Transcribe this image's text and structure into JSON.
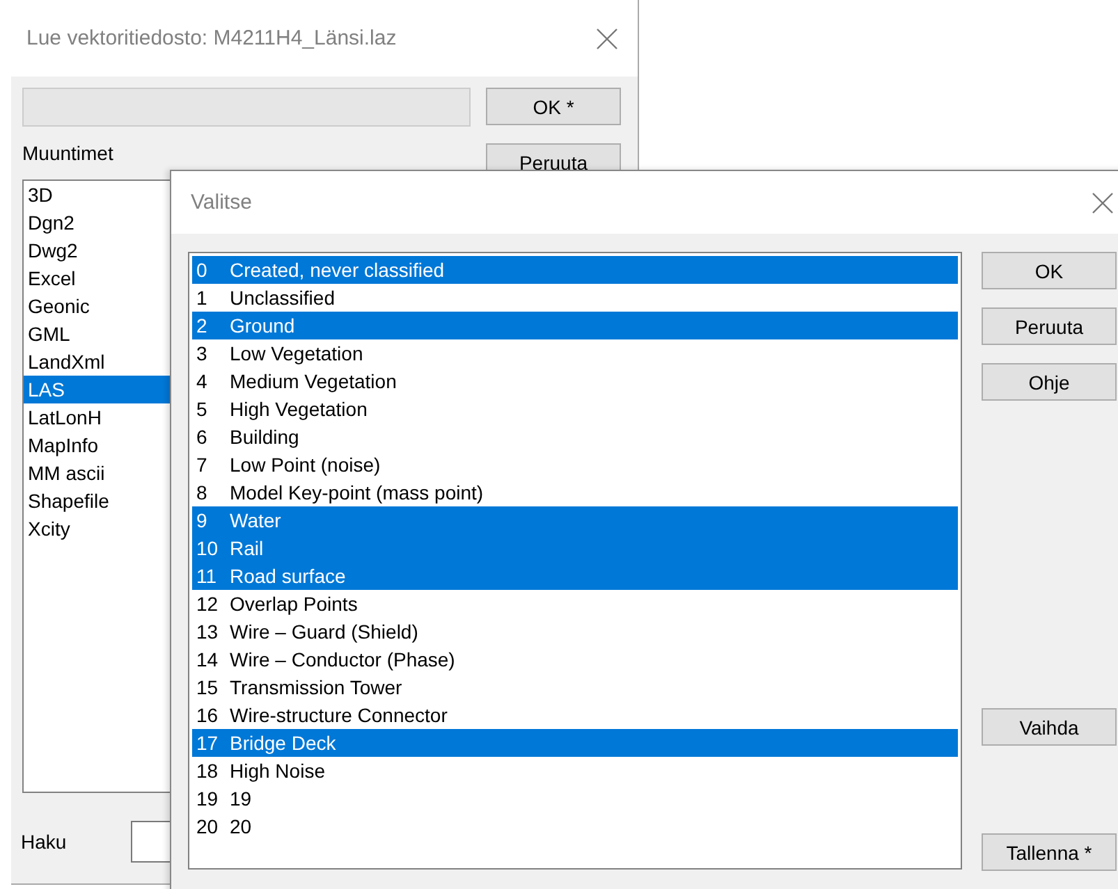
{
  "main_dialog": {
    "title": "Lue vektoritiedosto: M4211H4_Länsi.laz",
    "buttons": [
      "OK *",
      "Peruuta"
    ],
    "converters_label": "Muuntimet",
    "converters": [
      {
        "label": "3D",
        "selected": false
      },
      {
        "label": "Dgn2",
        "selected": false
      },
      {
        "label": "Dwg2",
        "selected": false
      },
      {
        "label": "Excel",
        "selected": false
      },
      {
        "label": "Geonic",
        "selected": false
      },
      {
        "label": "GML",
        "selected": false
      },
      {
        "label": "LandXml",
        "selected": false
      },
      {
        "label": "LAS",
        "selected": true
      },
      {
        "label": "LatLonH",
        "selected": false
      },
      {
        "label": "MapInfo",
        "selected": false
      },
      {
        "label": "MM ascii",
        "selected": false
      },
      {
        "label": "Shapefile",
        "selected": false
      },
      {
        "label": "Xcity",
        "selected": false
      }
    ],
    "search_label": "Haku"
  },
  "select_dialog": {
    "title": "Valitse",
    "classes": [
      {
        "number": "0",
        "label": "Created, never classified",
        "selected": true
      },
      {
        "number": "1",
        "label": "Unclassified",
        "selected": false
      },
      {
        "number": "2",
        "label": "Ground",
        "selected": true
      },
      {
        "number": "3",
        "label": "Low Vegetation",
        "selected": false
      },
      {
        "number": "4",
        "label": "Medium Vegetation",
        "selected": false
      },
      {
        "number": "5",
        "label": "High Vegetation",
        "selected": false
      },
      {
        "number": "6",
        "label": "Building",
        "selected": false
      },
      {
        "number": "7",
        "label": "Low Point (noise)",
        "selected": false
      },
      {
        "number": "8",
        "label": "Model Key-point (mass point)",
        "selected": false
      },
      {
        "number": "9",
        "label": "Water",
        "selected": true
      },
      {
        "number": "10",
        "label": "Rail",
        "selected": true
      },
      {
        "number": "11",
        "label": "Road surface",
        "selected": true
      },
      {
        "number": "12",
        "label": "Overlap Points",
        "selected": false
      },
      {
        "number": "13",
        "label": "Wire – Guard (Shield)",
        "selected": false
      },
      {
        "number": "14",
        "label": "Wire – Conductor (Phase)",
        "selected": false
      },
      {
        "number": "15",
        "label": "Transmission Tower",
        "selected": false
      },
      {
        "number": "16",
        "label": "Wire-structure Connector",
        "selected": false
      },
      {
        "number": "17",
        "label": "Bridge Deck",
        "selected": true
      },
      {
        "number": "18",
        "label": "High Noise",
        "selected": false
      },
      {
        "number": "19",
        "label": "19",
        "selected": false
      },
      {
        "number": "20",
        "label": "20",
        "selected": false
      }
    ],
    "top_buttons": [
      "OK",
      "Peruuta",
      "Ohje"
    ],
    "bottom_buttons": [
      "Vaihda",
      "Tallenna *"
    ]
  }
}
